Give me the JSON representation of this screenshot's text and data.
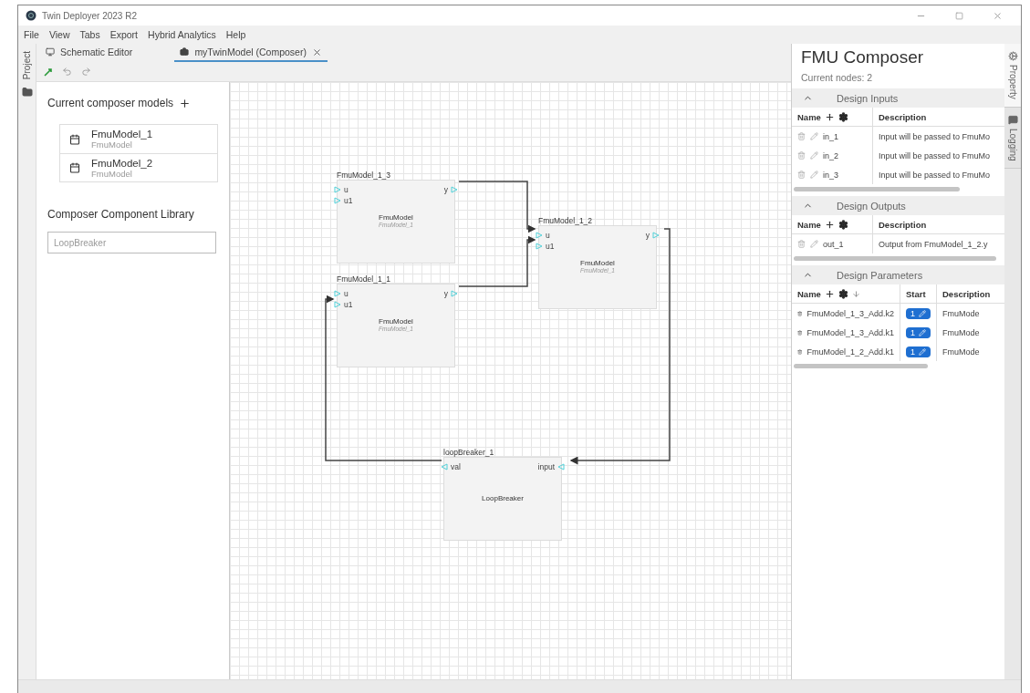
{
  "window": {
    "title": "Twin Deployer 2023 R2"
  },
  "menu": [
    "File",
    "View",
    "Tabs",
    "Export",
    "Hybrid Analytics",
    "Help"
  ],
  "left_rail": {
    "tabs": [
      {
        "label": "Project"
      }
    ]
  },
  "editor_tabs": [
    {
      "label": "Schematic Editor",
      "selected": false,
      "closable": false
    },
    {
      "label": "myTwinModel (Composer)",
      "selected": true,
      "closable": true
    }
  ],
  "composer_models": {
    "title": "Current composer models",
    "items": [
      {
        "name": "FmuModel_1",
        "type": "FmuModel"
      },
      {
        "name": "FmuModel_2",
        "type": "FmuModel"
      }
    ]
  },
  "component_library": {
    "title": "Composer Component Library",
    "search": {
      "placeholder": "LoopBreaker"
    }
  },
  "canvas": {
    "nodes": [
      {
        "kind": "fmu",
        "title": "FmuModel_1_3",
        "type": "FmuModel",
        "instance": "FmuModel_1",
        "inputs": [
          "u",
          "u1"
        ],
        "outputs": [
          "y"
        ]
      },
      {
        "kind": "fmu",
        "title": "FmuModel_1_2",
        "type": "FmuModel",
        "instance": "FmuModel_1",
        "inputs": [
          "u",
          "u1"
        ],
        "outputs": [
          "y"
        ]
      },
      {
        "kind": "fmu",
        "title": "FmuModel_1_1",
        "type": "FmuModel",
        "instance": "FmuModel_1",
        "inputs": [
          "u",
          "u1"
        ],
        "outputs": [
          "y"
        ]
      },
      {
        "kind": "loop_breaker",
        "title": "loopBreaker_1",
        "type": "LoopBreaker",
        "inputs": [
          "input"
        ],
        "outputs": [
          "val"
        ]
      }
    ]
  },
  "fmu_composer": {
    "title": "FMU Composer",
    "node_count": "Current nodes: 2",
    "sections": [
      {
        "title": "Design Inputs",
        "expanded": true,
        "columns": [
          {
            "label": "Name",
            "sorted": false
          },
          {
            "label": "Description",
            "sorted": false
          }
        ],
        "rows": [
          {
            "kind": "io",
            "cells": [
              "in_1",
              "Input will be passed to FmuMo"
            ]
          },
          {
            "kind": "io",
            "cells": [
              "in_2",
              "Input will be passed to FmuMo"
            ]
          },
          {
            "kind": "io",
            "cells": [
              "in_3",
              "Input will be passed to FmuMo"
            ]
          }
        ]
      },
      {
        "title": "Design Outputs",
        "expanded": true,
        "columns": [
          {
            "label": "Name",
            "sorted": false
          },
          {
            "label": "Description",
            "sorted": false
          }
        ],
        "rows": [
          {
            "kind": "io",
            "cells": [
              "out_1",
              "Output from FmuModel_1_2.y"
            ]
          }
        ]
      },
      {
        "title": "Design Parameters",
        "expanded": true,
        "columns": [
          {
            "label": "Name",
            "sorted": true
          },
          {
            "label": "Start",
            "sorted": false
          },
          {
            "label": "Description",
            "sorted": false
          }
        ],
        "rows": [
          {
            "kind": "param",
            "cells": [
              "FmuModel_1_3_Add.k2",
              "1",
              "FmuMode"
            ]
          },
          {
            "kind": "param",
            "cells": [
              "FmuModel_1_3_Add.k1",
              "1",
              "FmuMode"
            ]
          },
          {
            "kind": "param",
            "cells": [
              "FmuModel_1_2_Add.k1",
              "1",
              "FmuMode"
            ]
          }
        ]
      }
    ]
  },
  "right_rail": {
    "tabs": [
      {
        "label": "Property",
        "selected": true
      },
      {
        "label": "Logging",
        "selected": false
      }
    ]
  }
}
